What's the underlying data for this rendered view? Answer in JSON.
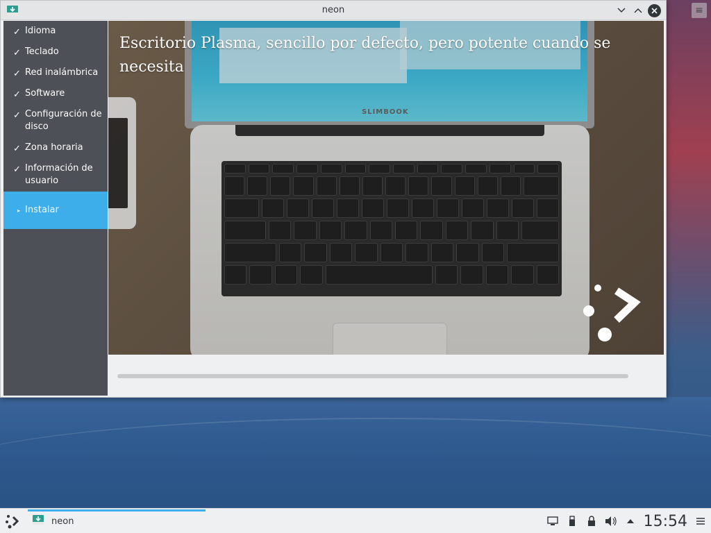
{
  "window": {
    "title": "neon"
  },
  "sidebar": {
    "items": [
      {
        "label": "Idioma",
        "done": true
      },
      {
        "label": "Teclado",
        "done": true
      },
      {
        "label": "Red inalámbrica",
        "done": true
      },
      {
        "label": "Software",
        "done": true
      },
      {
        "label": "Configuración de disco",
        "done": true
      },
      {
        "label": "Zona horaria",
        "done": true
      },
      {
        "label": "Información de usuario",
        "done": true
      },
      {
        "label": "Instalar",
        "done": false,
        "active": true
      }
    ],
    "check_glyph": "✓",
    "active_glyph": "▸"
  },
  "slide": {
    "title": "Escritorio Plasma, sencillo por defecto, pero potente cuando se necesita",
    "laptop_brand": "SLIMBOOK"
  },
  "progress": {
    "value_fraction": 0.0
  },
  "taskbar": {
    "task_label": "neon",
    "clock": "15:54",
    "tray_icons": [
      "display-icon",
      "usb-icon",
      "lock-icon",
      "volume-icon",
      "expand-tray-icon",
      "menu-icon"
    ]
  },
  "colors": {
    "accent": "#3daee9",
    "sidebar_bg": "#4d5157",
    "window_bg": "#eff0f1"
  }
}
